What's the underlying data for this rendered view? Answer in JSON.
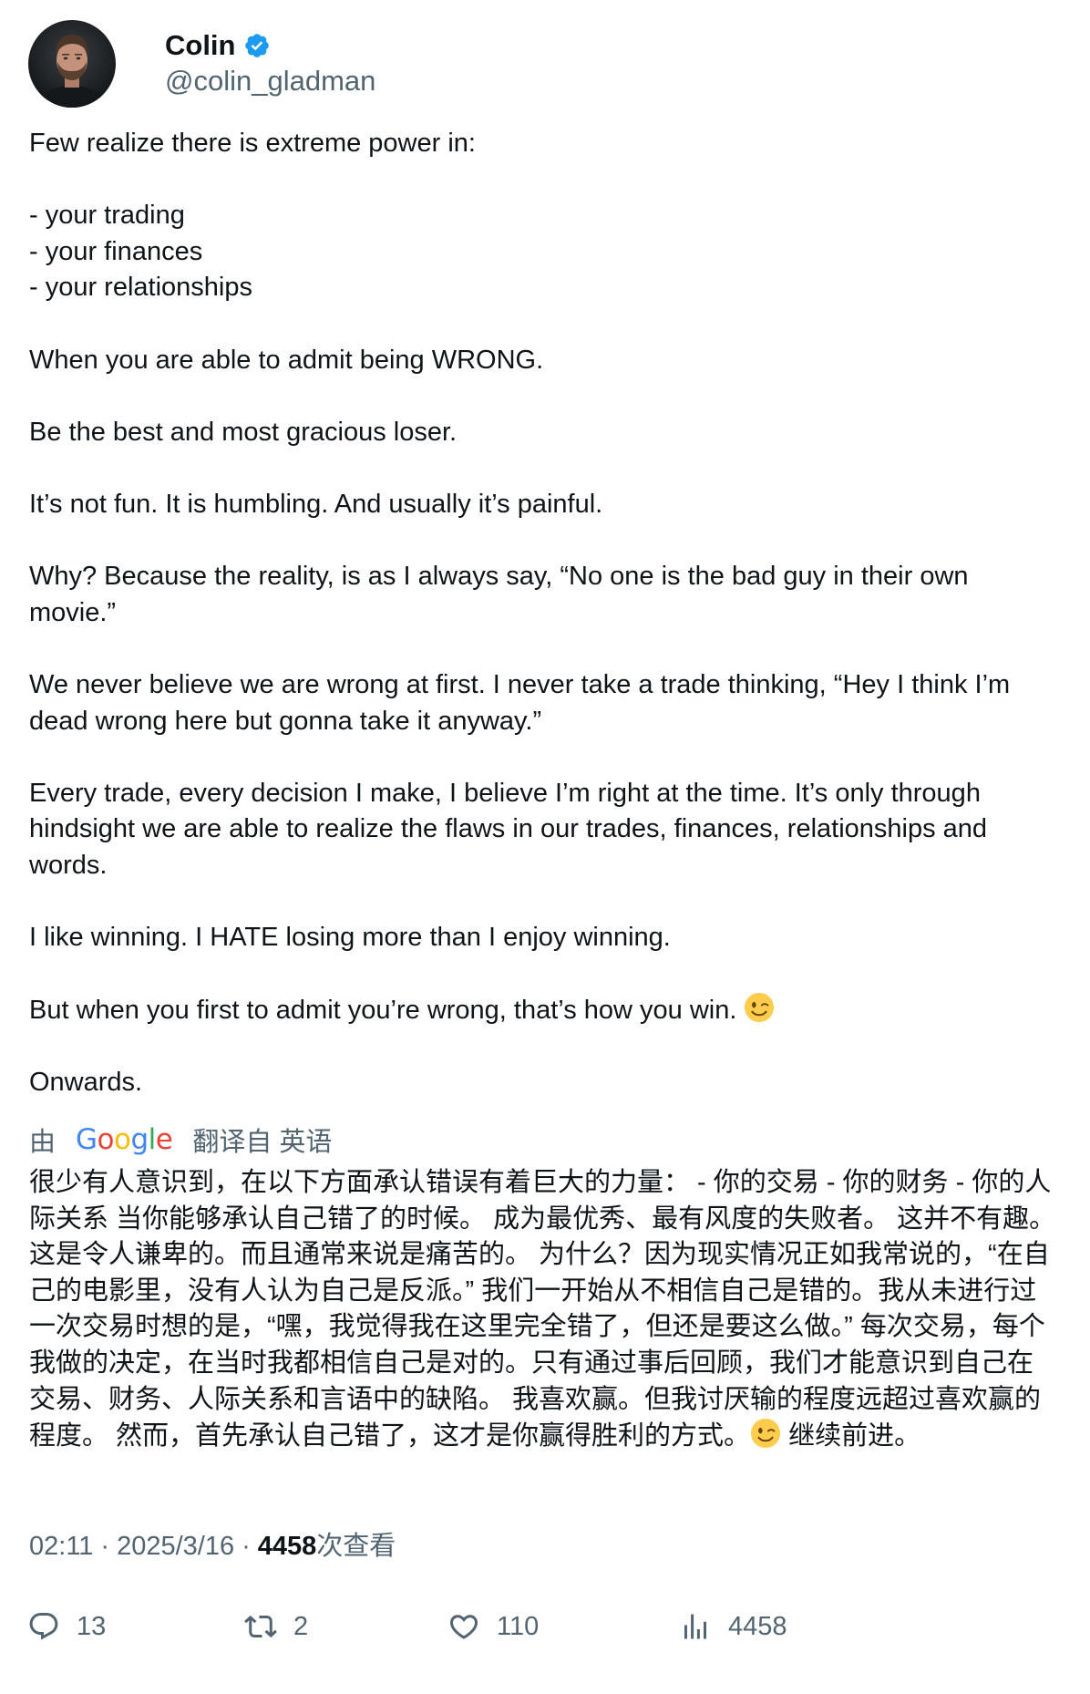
{
  "author": {
    "display_name": "Colin",
    "handle": "@colin_gladman",
    "verified_icon": "verified-badge-icon",
    "avatar_icon": "avatar-photo"
  },
  "tweet": {
    "lines": [
      "Few realize there is extreme power in:",
      "",
      "- your trading",
      "- your finances",
      "- your relationships",
      "",
      "When you are able to admit being WRONG.",
      "",
      "Be the best and most gracious loser.",
      "",
      "It’s not fun. It is humbling. And usually it’s painful.",
      "",
      "Why? Because the reality, is as I always say, “No one is the bad guy in their own movie.”",
      "",
      "We never believe we are wrong at first. I never take a trade thinking, “Hey I think I’m dead wrong here but gonna take it anyway.”",
      "",
      "Every trade, every decision I make, I believe I’m right at the time. It’s only through hindsight we are able to realize the flaws in our trades, finances, relationships and words.",
      "",
      "I like winning. I HATE losing more than I enjoy winning.",
      "",
      "But when you first to admit you’re wrong, that’s how you win."
    ],
    "closing": "Onwards."
  },
  "translation": {
    "by": "由",
    "provider": "Google",
    "from_label": "翻译自 英语",
    "text_before_emoji": "很少有人意识到，在以下方面承认错误有着巨大的力量： - 你的交易 - 你的财务 - 你的人际关系 当你能够承认自己错了的时候。 成为最优秀、最有风度的失败者。 这并不有趣。这是令人谦卑的。而且通常来说是痛苦的。 为什么？因为现实情况正如我常说的，“在自己的电影里，没有人认为自己是反派。” 我们一开始从不相信自己是错的。我从未进行过一次交易时想的是，“嘿，我觉得我在这里完全错了，但还是要这么做。” 每次交易，每个我做的决定，在当时我都相信自己是对的。只有通过事后回顾，我们才能意识到自己在交易、财务、人际关系和言语中的缺陷。 我喜欢赢。但我讨厌输的程度远超过喜欢赢的程度。 然而，首先承认自己错了，这才是你赢得胜利的方式。",
    "text_after_emoji": " 继续前进。"
  },
  "meta": {
    "time": "02:11",
    "date": "2025/3/16",
    "views_count": "4458",
    "views_label": "次查看",
    "separator": "·"
  },
  "actions": {
    "replies": "13",
    "retweets": "2",
    "likes": "110",
    "views": "4458"
  },
  "colors": {
    "text": "#0f1419",
    "secondary": "#536471",
    "verified": "#1d9bf0"
  }
}
